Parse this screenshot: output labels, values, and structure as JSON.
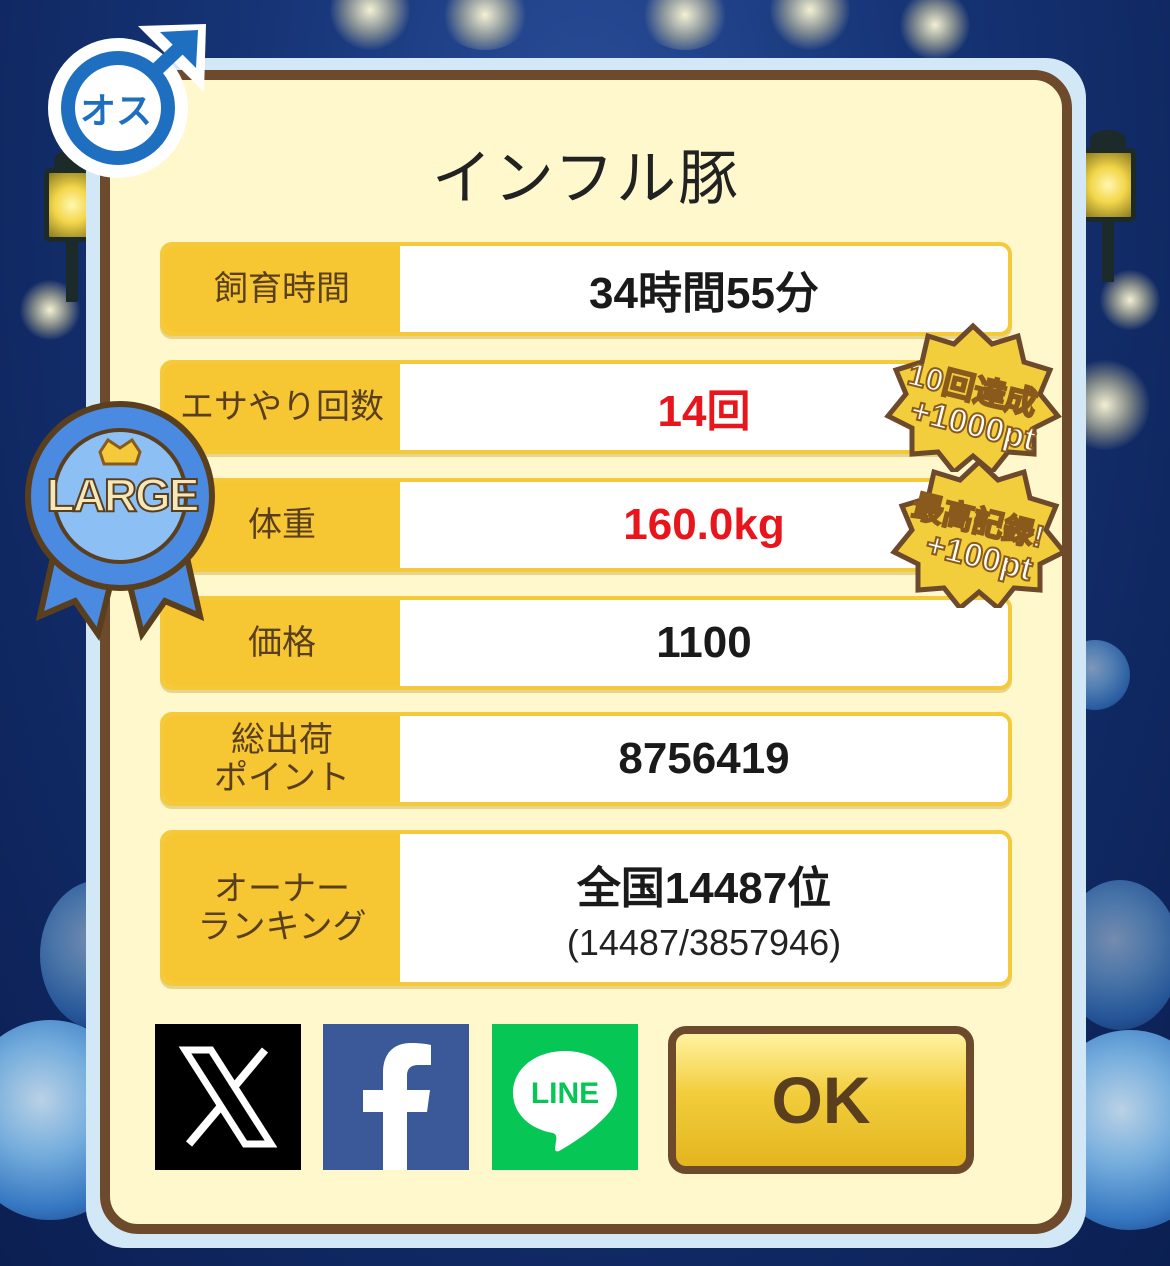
{
  "gender_badge": {
    "label": "オス"
  },
  "size_ribbon": {
    "label": "LARGE"
  },
  "dialog": {
    "title": "インフル豚",
    "rows": [
      {
        "label": "飼育時間",
        "value": "34時間55分"
      },
      {
        "label": "エサやり回数",
        "value": "14回"
      },
      {
        "label": "体重",
        "value": "160.0kg"
      },
      {
        "label": "価格",
        "value": "1100"
      },
      {
        "label": "総出荷\nポイント",
        "value": "8756419"
      },
      {
        "label": "オーナー\nランキング",
        "value": "全国14487位",
        "sub": "(14487/3857946)"
      }
    ],
    "stickers": [
      {
        "line1": "10回達成",
        "line2": "+1000pt"
      },
      {
        "line1": "最高記録!",
        "line2": "+100pt"
      }
    ],
    "share": {
      "x_label": "X",
      "facebook_label": "f",
      "line_label": "LINE"
    },
    "ok_label": "OK"
  },
  "colors": {
    "panel_bg": "#fff8cc",
    "panel_border": "#6d4a2c",
    "label_bg": "#f6c733",
    "highlight_red": "#e8161c",
    "facebook": "#3b5998",
    "line": "#06c755"
  }
}
